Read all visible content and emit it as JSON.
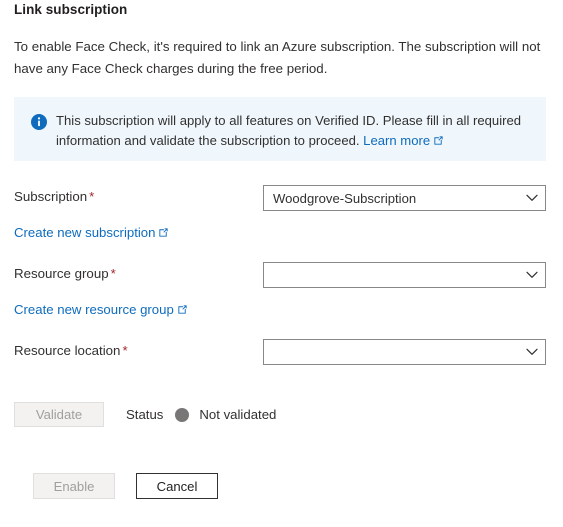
{
  "page": {
    "title": "Link subscription",
    "intro": "To enable Face Check, it's required to link an Azure subscription. The subscription will not have any Face Check charges during the free period."
  },
  "info_banner": {
    "icon": "info-circle-icon",
    "text": "This subscription will apply to all features on Verified ID. Please fill in all required information and validate the subscription to proceed.",
    "link_label": "Learn more",
    "link_icon": "external-link-icon",
    "background_color": "#eff6fc",
    "icon_color": "#0f6cbd"
  },
  "form": {
    "required_marker": "*",
    "required_color": "#a4262c",
    "fields": [
      {
        "label": "Subscription",
        "required": true,
        "value": "Woodgrove-Subscription",
        "placeholder": "",
        "chevron_icon": "chevron-down-icon"
      },
      {
        "label": "Resource group",
        "required": true,
        "value": "",
        "placeholder": "",
        "chevron_icon": "chevron-down-icon"
      },
      {
        "label": "Resource location",
        "required": true,
        "value": "",
        "placeholder": "",
        "chevron_icon": "chevron-down-icon"
      }
    ],
    "links": [
      {
        "label": "Create new subscription",
        "icon": "external-link-icon"
      },
      {
        "label": "Create new resource group",
        "icon": "external-link-icon"
      }
    ]
  },
  "validation": {
    "validate_label": "Validate",
    "validate_enabled": false,
    "status_label": "Status",
    "status_value": "Not validated",
    "status_color": "#797775"
  },
  "footer": {
    "enable_label": "Enable",
    "enable_enabled": false,
    "cancel_label": "Cancel"
  }
}
